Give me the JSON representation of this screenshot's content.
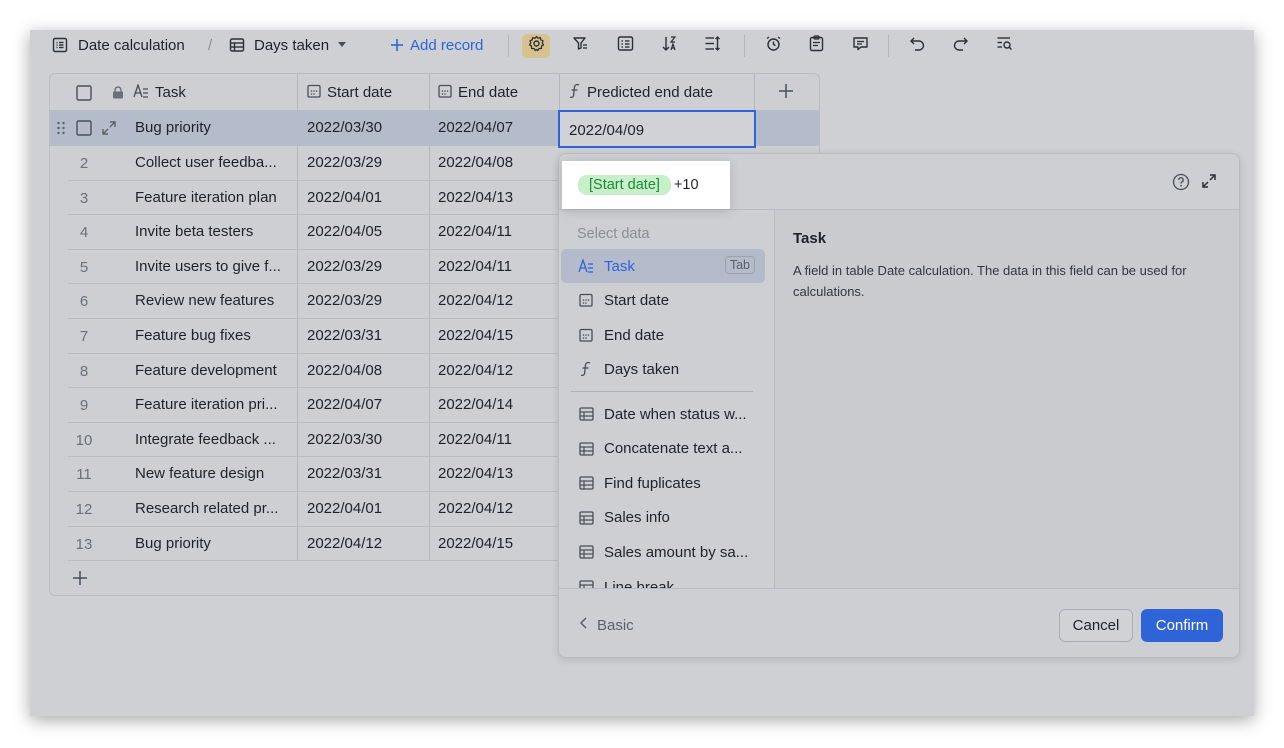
{
  "toolbar": {
    "table_name": "Date calculation",
    "separator": "/",
    "view_name": "Days taken",
    "add_record": "Add record"
  },
  "grid": {
    "columns": [
      "Task",
      "Start date",
      "End date",
      "Predicted end date"
    ],
    "selected_row": {
      "task": "Bug priority",
      "start": "2022/03/30",
      "end": "2022/04/07"
    },
    "editing_value": "2022/04/09",
    "rows": [
      {
        "num": "2",
        "task": "Collect user feedba...",
        "start": "2022/03/29",
        "end": "2022/04/08"
      },
      {
        "num": "3",
        "task": "Feature iteration plan",
        "start": "2022/04/01",
        "end": "2022/04/13"
      },
      {
        "num": "4",
        "task": "Invite beta testers",
        "start": "2022/04/05",
        "end": "2022/04/11"
      },
      {
        "num": "5",
        "task": "Invite users to give f...",
        "start": "2022/03/29",
        "end": "2022/04/11"
      },
      {
        "num": "6",
        "task": "Review new features",
        "start": "2022/03/29",
        "end": "2022/04/12"
      },
      {
        "num": "7",
        "task": "Feature bug fixes",
        "start": "2022/03/31",
        "end": "2022/04/15"
      },
      {
        "num": "8",
        "task": "Feature development",
        "start": "2022/04/08",
        "end": "2022/04/12"
      },
      {
        "num": "9",
        "task": "Feature iteration pri...",
        "start": "2022/04/07",
        "end": "2022/04/14"
      },
      {
        "num": "10",
        "task": "Integrate feedback ...",
        "start": "2022/03/30",
        "end": "2022/04/11"
      },
      {
        "num": "11",
        "task": "New feature design",
        "start": "2022/03/31",
        "end": "2022/04/13"
      },
      {
        "num": "12",
        "task": "Research related pr...",
        "start": "2022/04/01",
        "end": "2022/04/12"
      },
      {
        "num": "13",
        "task": "Bug priority",
        "start": "2022/04/12",
        "end": "2022/04/15"
      }
    ]
  },
  "formula": {
    "chip": "[Start date]",
    "rest": "+10"
  },
  "panel": {
    "section_label": "Select data",
    "fields": [
      {
        "label": "Task",
        "icon": "text-icon"
      },
      {
        "label": "Start date",
        "icon": "date-icon"
      },
      {
        "label": "End date",
        "icon": "date-icon"
      },
      {
        "label": "Days taken",
        "icon": "formula-icon"
      }
    ],
    "tab_hint": "Tab",
    "tables": [
      "Date when status w...",
      "Concatenate text a...",
      "Find fuplicates",
      "Sales info",
      "Sales amount by sa...",
      "Line break"
    ],
    "help_title": "Task",
    "help_desc": "A field in table Date calculation. The data in this field can be used for calculations.",
    "basic": "Basic",
    "cancel": "Cancel",
    "confirm": "Confirm"
  },
  "colors": {
    "accent": "#2f64d8",
    "chip_bg": "#c7efc9",
    "chip_text": "#1f8a35"
  }
}
